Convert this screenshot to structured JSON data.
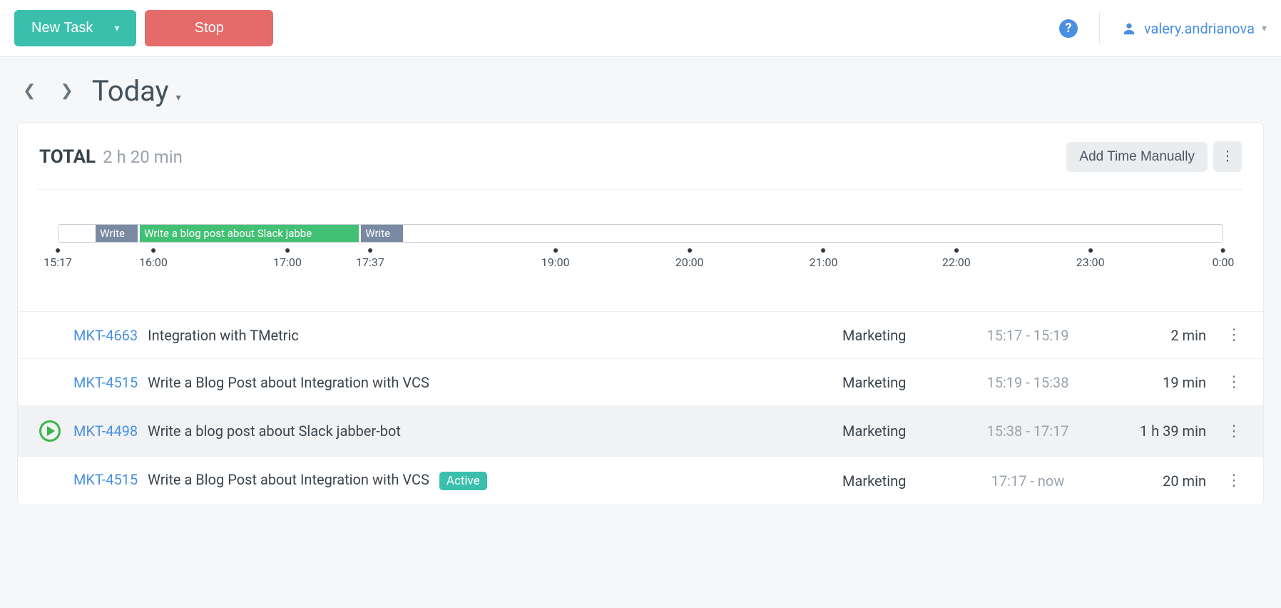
{
  "topbar": {
    "new_task_label": "New Task",
    "stop_label": "Stop",
    "help_icon": "?",
    "user_name": "valery.andrianova"
  },
  "date_nav": {
    "title": "Today"
  },
  "summary": {
    "total_label": "TOTAL",
    "total_value": "2 h 20 min",
    "add_manually_label": "Add Time Manually"
  },
  "timeline": {
    "ticks": [
      "15:17",
      "16:00",
      "17:00",
      "17:37",
      "19:00",
      "20:00",
      "21:00",
      "22:00",
      "23:00",
      "0:00"
    ],
    "tick_positions_pct": [
      0,
      8.2,
      19.7,
      26.8,
      42.7,
      54.2,
      65.7,
      77.1,
      88.6,
      100
    ],
    "blocks": [
      {
        "label": "",
        "start_pct": 0,
        "width_pct": 3.0,
        "color": "white"
      },
      {
        "label": "Write",
        "start_pct": 3.2,
        "width_pct": 3.6,
        "color": "grey"
      },
      {
        "label": "Write a blog post about Slack jabbe",
        "start_pct": 7.0,
        "width_pct": 18.8,
        "color": "green"
      },
      {
        "label": "Write",
        "start_pct": 26.0,
        "width_pct": 3.6,
        "color": "grey"
      }
    ]
  },
  "entries": [
    {
      "play": false,
      "ticket": "MKT-4663",
      "desc": "Integration with TMetric",
      "badge": null,
      "project": "Marketing",
      "range": "15:17 - 15:19",
      "duration": "2 min",
      "highlight": false
    },
    {
      "play": false,
      "ticket": "MKT-4515",
      "desc": "Write a Blog Post about Integration with VCS",
      "badge": null,
      "project": "Marketing",
      "range": "15:19 - 15:38",
      "duration": "19 min",
      "highlight": false
    },
    {
      "play": true,
      "ticket": "MKT-4498",
      "desc": "Write a blog post about Slack jabber-bot",
      "badge": null,
      "project": "Marketing",
      "range": "15:38 - 17:17",
      "duration": "1 h 39 min",
      "highlight": true
    },
    {
      "play": false,
      "ticket": "MKT-4515",
      "desc": "Write a Blog Post about Integration with VCS",
      "badge": "Active",
      "project": "Marketing",
      "range": "17:17 - now",
      "duration": "20 min",
      "highlight": false
    }
  ]
}
